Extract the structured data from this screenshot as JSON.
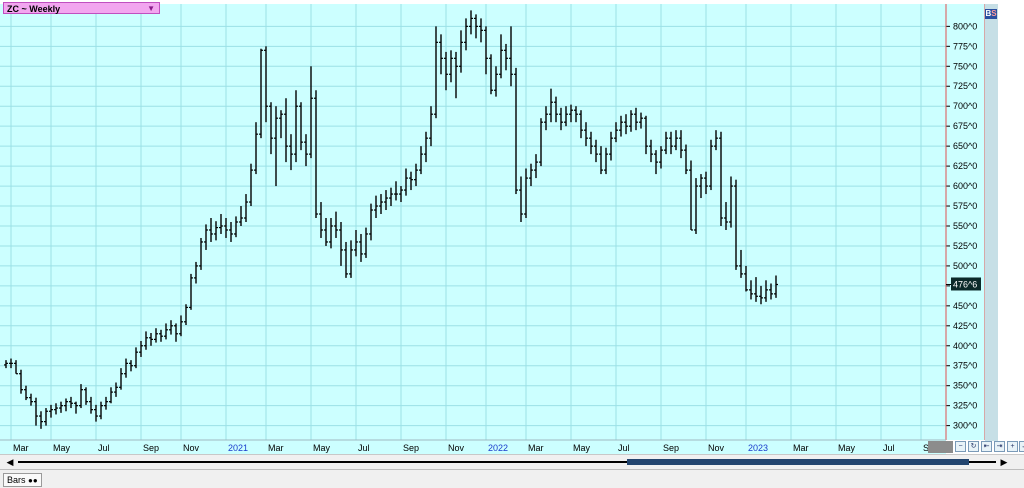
{
  "header": {
    "symbol_label": "ZC ~ Weekly",
    "dropdown_icon": "triangle-down-icon",
    "buy_sell_b": "B",
    "buy_sell_s": "S"
  },
  "colors": {
    "plot_bg": "#ccffff",
    "grid": "#9be0e6",
    "bars": "#000000",
    "price_axis_line": "#e05050",
    "last_price_bg": "#0b2a2a",
    "last_price_text": "#ffffff"
  },
  "footer": {
    "tab_label": "Bars",
    "tab_icon": "double-dot-icon",
    "scroll_left_icon": "triangle-left-icon",
    "scroll_right_icon": "triangle-right-icon"
  },
  "chart_data": {
    "type": "bar",
    "style": "OHLC weekly price bars",
    "grid": true,
    "y_axis_position": "right",
    "ylim": [
      282,
      828
    ],
    "y_ticks": [
      "300^0",
      "325^0",
      "350^0",
      "375^0",
      "400^0",
      "425^0",
      "450^0",
      "475^0",
      "500^0",
      "525^0",
      "550^0",
      "575^0",
      "600^0",
      "625^0",
      "650^0",
      "675^0",
      "700^0",
      "725^0",
      "750^0",
      "775^0",
      "800^0"
    ],
    "y_tick_values": [
      300,
      325,
      350,
      375,
      400,
      425,
      450,
      475,
      500,
      525,
      550,
      575,
      600,
      625,
      650,
      675,
      700,
      725,
      750,
      775,
      800
    ],
    "x_ticks": [
      {
        "label": "Mar",
        "week": 1,
        "year": false
      },
      {
        "label": "May",
        "week": 9,
        "year": false
      },
      {
        "label": "Jul",
        "week": 18,
        "year": false
      },
      {
        "label": "Sep",
        "week": 27,
        "year": false
      },
      {
        "label": "Nov",
        "week": 35,
        "year": false
      },
      {
        "label": "2021",
        "week": 44,
        "year": true
      },
      {
        "label": "Mar",
        "week": 52,
        "year": false
      },
      {
        "label": "May",
        "week": 61,
        "year": false
      },
      {
        "label": "Jul",
        "week": 70,
        "year": false
      },
      {
        "label": "Sep",
        "week": 79,
        "year": false
      },
      {
        "label": "Nov",
        "week": 88,
        "year": false
      },
      {
        "label": "2022",
        "week": 96,
        "year": true
      },
      {
        "label": "Mar",
        "week": 104,
        "year": false
      },
      {
        "label": "May",
        "week": 113,
        "year": false
      },
      {
        "label": "Jul",
        "week": 122,
        "year": false
      },
      {
        "label": "Sep",
        "week": 131,
        "year": false
      },
      {
        "label": "Nov",
        "week": 140,
        "year": false
      },
      {
        "label": "2023",
        "week": 148,
        "year": true
      },
      {
        "label": "Mar",
        "week": 157,
        "year": false
      },
      {
        "label": "May",
        "week": 166,
        "year": false
      },
      {
        "label": "Jul",
        "week": 175,
        "year": false
      },
      {
        "label": "Sep",
        "week": 183,
        "year": false
      }
    ],
    "last_price_label": "476^6",
    "last_price_value": 476.75,
    "close_values": [
      378,
      378,
      365,
      345,
      335,
      330,
      312,
      305,
      318,
      320,
      322,
      325,
      330,
      328,
      325,
      345,
      330,
      320,
      312,
      325,
      330,
      342,
      348,
      365,
      378,
      375,
      392,
      400,
      410,
      408,
      415,
      412,
      420,
      425,
      415,
      430,
      448,
      485,
      500,
      530,
      545,
      540,
      548,
      550,
      545,
      540,
      555,
      560,
      580,
      620,
      665,
      770,
      700,
      660,
      685,
      690,
      650,
      640,
      700,
      655,
      640,
      710,
      565,
      545,
      530,
      550,
      545,
      520,
      490,
      520,
      530,
      515,
      540,
      570,
      575,
      580,
      585,
      590,
      590,
      595,
      610,
      608,
      620,
      640,
      660,
      690,
      780,
      760,
      740,
      760,
      750,
      780,
      800,
      810,
      800,
      795,
      760,
      720,
      740,
      770,
      760,
      740,
      595,
      565,
      610,
      620,
      630,
      680,
      690,
      705,
      690,
      680,
      690,
      695,
      690,
      670,
      660,
      650,
      640,
      620,
      640,
      660,
      670,
      680,
      675,
      690,
      680,
      685,
      650,
      640,
      630,
      645,
      660,
      650,
      660,
      645,
      620,
      545,
      600,
      610,
      600,
      650,
      660,
      560,
      555,
      600,
      500,
      490,
      470,
      465,
      462,
      460,
      470,
      465,
      476.75
    ],
    "ohlc_bars": [
      [
        376,
        382,
        372,
        378
      ],
      [
        378,
        384,
        372,
        378
      ],
      [
        378,
        382,
        365,
        365
      ],
      [
        365,
        370,
        340,
        345
      ],
      [
        345,
        350,
        332,
        335
      ],
      [
        335,
        340,
        325,
        330
      ],
      [
        330,
        335,
        300,
        312
      ],
      [
        312,
        318,
        296,
        305
      ],
      [
        305,
        322,
        300,
        318
      ],
      [
        318,
        326,
        310,
        320
      ],
      [
        320,
        328,
        314,
        322
      ],
      [
        322,
        330,
        316,
        325
      ],
      [
        325,
        334,
        318,
        330
      ],
      [
        330,
        336,
        322,
        328
      ],
      [
        328,
        330,
        315,
        325
      ],
      [
        325,
        352,
        322,
        345
      ],
      [
        345,
        348,
        326,
        330
      ],
      [
        330,
        336,
        315,
        320
      ],
      [
        320,
        326,
        305,
        312
      ],
      [
        312,
        330,
        308,
        325
      ],
      [
        325,
        336,
        320,
        330
      ],
      [
        330,
        348,
        328,
        342
      ],
      [
        342,
        354,
        336,
        348
      ],
      [
        348,
        372,
        345,
        365
      ],
      [
        365,
        384,
        360,
        378
      ],
      [
        378,
        382,
        368,
        375
      ],
      [
        375,
        398,
        372,
        392
      ],
      [
        392,
        406,
        386,
        400
      ],
      [
        400,
        418,
        395,
        410
      ],
      [
        410,
        416,
        400,
        408
      ],
      [
        408,
        422,
        404,
        415
      ],
      [
        415,
        420,
        405,
        412
      ],
      [
        412,
        428,
        408,
        420
      ],
      [
        420,
        432,
        414,
        425
      ],
      [
        425,
        428,
        405,
        415
      ],
      [
        415,
        438,
        412,
        430
      ],
      [
        430,
        452,
        426,
        448
      ],
      [
        448,
        490,
        445,
        485
      ],
      [
        485,
        505,
        478,
        500
      ],
      [
        500,
        535,
        495,
        530
      ],
      [
        530,
        552,
        520,
        545
      ],
      [
        545,
        560,
        530,
        540
      ],
      [
        540,
        556,
        532,
        548
      ],
      [
        548,
        565,
        540,
        550
      ],
      [
        550,
        560,
        535,
        545
      ],
      [
        545,
        555,
        530,
        540
      ],
      [
        540,
        562,
        536,
        555
      ],
      [
        555,
        575,
        550,
        560
      ],
      [
        560,
        590,
        555,
        580
      ],
      [
        580,
        628,
        575,
        620
      ],
      [
        620,
        680,
        615,
        665
      ],
      [
        665,
        772,
        660,
        770
      ],
      [
        770,
        775,
        680,
        700
      ],
      [
        700,
        705,
        640,
        660
      ],
      [
        660,
        700,
        600,
        685
      ],
      [
        685,
        695,
        660,
        690
      ],
      [
        690,
        710,
        630,
        650
      ],
      [
        650,
        665,
        620,
        640
      ],
      [
        640,
        720,
        630,
        700
      ],
      [
        700,
        705,
        645,
        655
      ],
      [
        655,
        665,
        625,
        640
      ],
      [
        640,
        750,
        635,
        710
      ],
      [
        710,
        720,
        560,
        565
      ],
      [
        565,
        580,
        535,
        545
      ],
      [
        545,
        560,
        525,
        530
      ],
      [
        530,
        560,
        522,
        550
      ],
      [
        550,
        568,
        535,
        545
      ],
      [
        545,
        555,
        500,
        520
      ],
      [
        520,
        530,
        485,
        490
      ],
      [
        490,
        532,
        485,
        520
      ],
      [
        520,
        545,
        512,
        530
      ],
      [
        530,
        540,
        505,
        515
      ],
      [
        515,
        548,
        510,
        540
      ],
      [
        540,
        578,
        532,
        570
      ],
      [
        570,
        588,
        560,
        575
      ],
      [
        575,
        590,
        565,
        580
      ],
      [
        580,
        595,
        570,
        585
      ],
      [
        585,
        598,
        575,
        590
      ],
      [
        590,
        606,
        582,
        590
      ],
      [
        590,
        600,
        580,
        595
      ],
      [
        595,
        622,
        588,
        610
      ],
      [
        610,
        618,
        595,
        608
      ],
      [
        608,
        628,
        600,
        620
      ],
      [
        620,
        650,
        615,
        640
      ],
      [
        640,
        668,
        630,
        660
      ],
      [
        660,
        700,
        650,
        690
      ],
      [
        690,
        800,
        685,
        780
      ],
      [
        780,
        790,
        740,
        760
      ],
      [
        760,
        768,
        720,
        740
      ],
      [
        740,
        770,
        730,
        760
      ],
      [
        760,
        768,
        710,
        750
      ],
      [
        750,
        795,
        742,
        780
      ],
      [
        780,
        810,
        770,
        800
      ],
      [
        800,
        820,
        790,
        810
      ],
      [
        810,
        815,
        785,
        800
      ],
      [
        800,
        810,
        780,
        795
      ],
      [
        795,
        800,
        740,
        760
      ],
      [
        760,
        765,
        715,
        720
      ],
      [
        720,
        750,
        712,
        740
      ],
      [
        740,
        790,
        735,
        770
      ],
      [
        770,
        778,
        745,
        760
      ],
      [
        760,
        800,
        725,
        740
      ],
      [
        740,
        748,
        590,
        595
      ],
      [
        595,
        612,
        555,
        565
      ],
      [
        565,
        622,
        560,
        610
      ],
      [
        610,
        628,
        600,
        620
      ],
      [
        620,
        640,
        610,
        630
      ],
      [
        630,
        685,
        625,
        680
      ],
      [
        680,
        700,
        670,
        690
      ],
      [
        690,
        722,
        680,
        705
      ],
      [
        705,
        712,
        680,
        690
      ],
      [
        690,
        698,
        670,
        680
      ],
      [
        680,
        700,
        675,
        690
      ],
      [
        690,
        702,
        680,
        695
      ],
      [
        695,
        700,
        680,
        690
      ],
      [
        690,
        695,
        660,
        670
      ],
      [
        670,
        680,
        650,
        660
      ],
      [
        660,
        668,
        640,
        650
      ],
      [
        650,
        658,
        630,
        640
      ],
      [
        640,
        650,
        615,
        620
      ],
      [
        620,
        648,
        615,
        640
      ],
      [
        640,
        668,
        632,
        660
      ],
      [
        660,
        680,
        655,
        670
      ],
      [
        670,
        688,
        662,
        680
      ],
      [
        680,
        690,
        665,
        675
      ],
      [
        675,
        695,
        668,
        690
      ],
      [
        690,
        698,
        670,
        680
      ],
      [
        680,
        692,
        672,
        685
      ],
      [
        685,
        688,
        640,
        650
      ],
      [
        650,
        658,
        630,
        640
      ],
      [
        640,
        645,
        615,
        630
      ],
      [
        630,
        650,
        622,
        645
      ],
      [
        645,
        668,
        640,
        660
      ],
      [
        660,
        668,
        640,
        650
      ],
      [
        650,
        670,
        645,
        660
      ],
      [
        660,
        670,
        635,
        645
      ],
      [
        645,
        652,
        615,
        620
      ],
      [
        620,
        632,
        545,
        545
      ],
      [
        545,
        610,
        540,
        600
      ],
      [
        600,
        615,
        585,
        610
      ],
      [
        610,
        618,
        590,
        600
      ],
      [
        600,
        658,
        595,
        650
      ],
      [
        650,
        670,
        645,
        660
      ],
      [
        660,
        668,
        550,
        560
      ],
      [
        560,
        580,
        545,
        555
      ],
      [
        555,
        612,
        548,
        600
      ],
      [
        600,
        608,
        495,
        500
      ],
      [
        500,
        520,
        485,
        490
      ],
      [
        490,
        500,
        468,
        470
      ],
      [
        470,
        482,
        458,
        465
      ],
      [
        465,
        486,
        455,
        462
      ],
      [
        462,
        475,
        452,
        460
      ],
      [
        460,
        482,
        455,
        470
      ],
      [
        470,
        478,
        458,
        465
      ],
      [
        465,
        488,
        460,
        476.75
      ]
    ]
  }
}
